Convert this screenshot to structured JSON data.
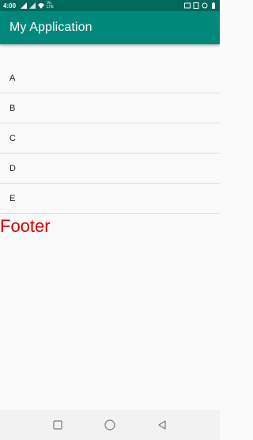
{
  "status_bar": {
    "time": "4:00",
    "network_label": "Vo LTE",
    "battery_icon": "battery-icon"
  },
  "app_bar": {
    "title": "My Application"
  },
  "list": {
    "items": [
      "A",
      "B",
      "C",
      "D",
      "E"
    ]
  },
  "footer": {
    "text": "Footer"
  },
  "colors": {
    "status_bar": "#00695c",
    "app_bar": "#00897b",
    "footer_text": "#d50000",
    "background": "#fafafa"
  }
}
